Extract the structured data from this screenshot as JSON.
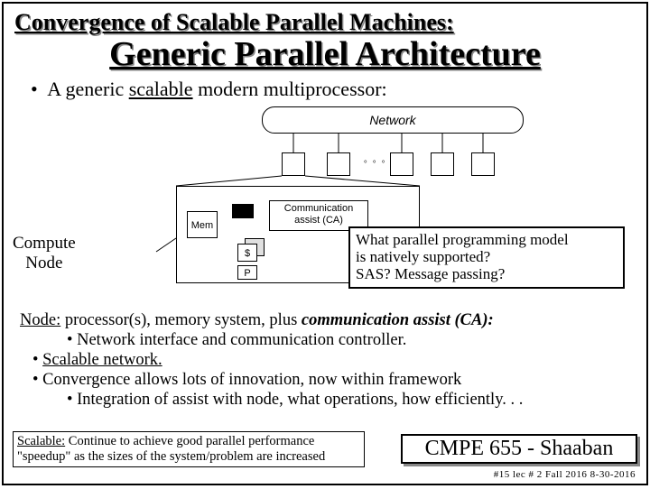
{
  "title1": "Convergence of Scalable Parallel Machines:",
  "title2": "Generic Parallel Architecture",
  "bullet_intro_pre": "A generic ",
  "bullet_intro_ul": "scalable",
  "bullet_intro_post": " modern multiprocessor:",
  "diagram": {
    "network": "Network",
    "mem": "Mem",
    "ca_l1": "Communication",
    "ca_l2": "assist (CA)",
    "cache": "$",
    "proc": "P"
  },
  "compute_label_l1": "Compute",
  "compute_label_l2": "Node",
  "callout_l1": "What parallel programming model",
  "callout_l2": "is natively supported?",
  "callout_l3": "SAS?  Message passing?",
  "body": {
    "node_label": "Node:",
    "node_rest": " processor(s), memory system, plus ",
    "node_ca": "communication assist (CA):",
    "net_iface": "Network interface and communication controller.",
    "scalable_net": "Scalable network.",
    "convergence": "Convergence allows lots of innovation, now within framework",
    "integration": "Integration of assist with node, what operations, how efficiently. . ."
  },
  "footer_left_label": "Scalable:",
  "footer_left_l1": "  Continue to achieve good parallel performance",
  "footer_left_l2": "\"speedup\" as the sizes of the system/problem are increased",
  "footer_right": "CMPE 655 - Shaaban",
  "footer_tiny": "#15   lec # 2    Fall 2016   8-30-2016"
}
